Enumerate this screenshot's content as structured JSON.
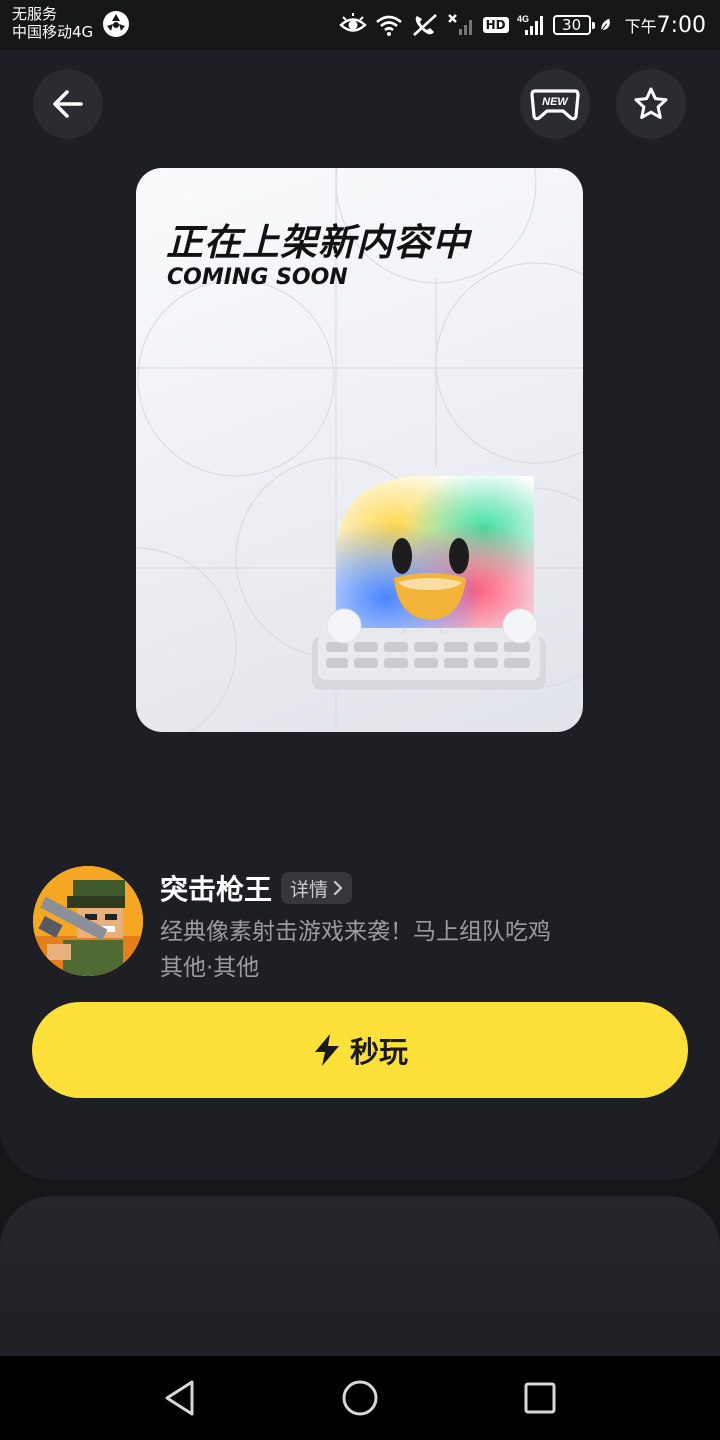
{
  "status_bar": {
    "carrier_line1": "无服务",
    "carrier_line2": "中国移动4G",
    "hd_badge": "HD",
    "network_type": "4G",
    "battery_level": "30",
    "time_prefix": "下午",
    "time": "7:00"
  },
  "cover": {
    "title": "正在上架新内容中",
    "subtitle": "COMING SOON"
  },
  "header": {
    "new_badge": "NEW"
  },
  "game": {
    "name": "突击枪王",
    "details_label": "详情",
    "description": "经典像素射击游戏来袭！马上组队吃鸡",
    "tags": "其他·其他"
  },
  "play_button": {
    "label": "秒玩"
  },
  "colors": {
    "background": "#161719",
    "panel": "#1e1f24",
    "accent_yellow": "#fde03a",
    "muted_text": "#9a9ba1"
  }
}
